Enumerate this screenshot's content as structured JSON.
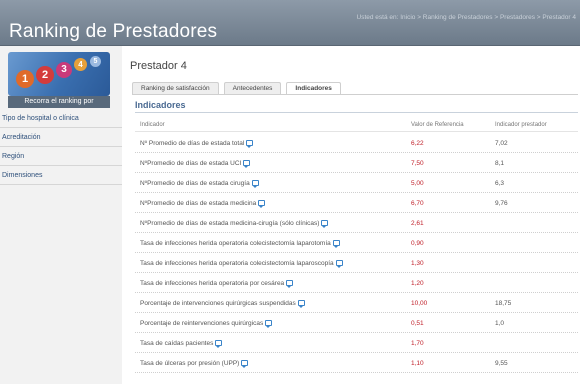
{
  "header": {
    "title": "Ranking de Prestadores",
    "breadcrumb": "Usted está en: Inicio > Ranking de Prestadores > Prestadores > Prestador 4"
  },
  "sidebar": {
    "banner_balls": [
      "1",
      "2",
      "3",
      "4",
      "5"
    ],
    "heading": "Recorra el ranking por",
    "items": [
      {
        "label": "Tipo de hospital o clínica"
      },
      {
        "label": "Acreditación"
      },
      {
        "label": "Región"
      },
      {
        "label": "Dimensiones"
      }
    ]
  },
  "main": {
    "title": "Prestador 4",
    "tabs": [
      {
        "label": "Ranking de satisfacción",
        "active": false
      },
      {
        "label": "Antecedentes",
        "active": false
      },
      {
        "label": "Indicadores",
        "active": true
      }
    ],
    "section_title": "Indicadores",
    "table": {
      "headers": [
        "Indicador",
        "Valor de Referencia",
        "Indicador prestador"
      ],
      "rows": [
        {
          "indicador": "Nº Promedio de días de estada total",
          "referencia": "6,22",
          "prestador": "7,02"
        },
        {
          "indicador": "NºPromedio de días de estada UCI",
          "referencia": "7,50",
          "prestador": "8,1"
        },
        {
          "indicador": "NºPromedio de días de estada cirugía",
          "referencia": "5,00",
          "prestador": "6,3"
        },
        {
          "indicador": "NºPromedio de días de estada medicina",
          "referencia": "6,70",
          "prestador": "9,76"
        },
        {
          "indicador": "NºPromedio de días de estada medicina-cirugía (sólo clínicas)",
          "referencia": "2,61",
          "prestador": ""
        },
        {
          "indicador": "Tasa de infecciones herida operatoria colecistectomía laparotomía",
          "referencia": "0,90",
          "prestador": ""
        },
        {
          "indicador": "Tasa de infecciones herida operatoria colecistectomía laparoscopía",
          "referencia": "1,30",
          "prestador": ""
        },
        {
          "indicador": "Tasa de infecciones herida operatoria por cesárea",
          "referencia": "1,20",
          "prestador": ""
        },
        {
          "indicador": "Porcentaje de intervenciones quirúrgicas suspendidas",
          "referencia": "10,00",
          "prestador": "18,75"
        },
        {
          "indicador": "Porcentaje de reintervenciones quirúrgicas",
          "referencia": "0,51",
          "prestador": "1,0"
        },
        {
          "indicador": "Tasa de caídas pacientes",
          "referencia": "1,70",
          "prestador": ""
        },
        {
          "indicador": "Tasa de úlceras por presión (UPP)",
          "referencia": "1,10",
          "prestador": "9,55"
        }
      ]
    }
  },
  "colors": {
    "header_bg": "#7c8a98",
    "sidebar_heading_bg": "#58697b",
    "reference_value": "#c0202a",
    "section_title": "#4a6a92",
    "info_icon": "#3a84c9"
  }
}
